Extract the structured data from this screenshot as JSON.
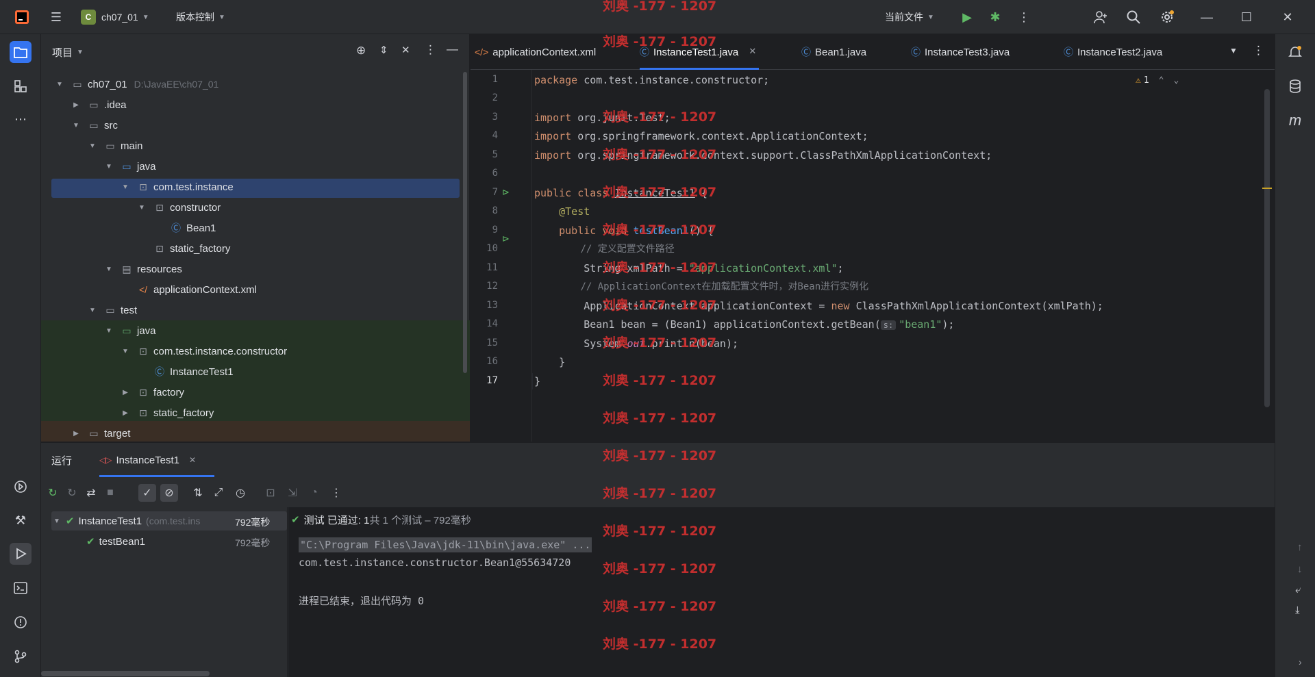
{
  "titlebar": {
    "project": "ch07_01",
    "project_badge": "C",
    "vcs": "版本控制",
    "run_config": "当前文件"
  },
  "project_panel": {
    "title": "项目",
    "tree": [
      {
        "label": "ch07_01",
        "extra": "D:\\JavaEE\\ch07_01",
        "icon": "folder-icon"
      },
      {
        "label": ".idea",
        "icon": "folder-icon"
      },
      {
        "label": "src",
        "icon": "folder-icon"
      },
      {
        "label": "main",
        "icon": "folder-icon"
      },
      {
        "label": "java",
        "icon": "source-folder-icon"
      },
      {
        "label": "com.test.instance",
        "icon": "package-icon"
      },
      {
        "label": "constructor",
        "icon": "package-icon"
      },
      {
        "label": "Bean1",
        "icon": "class-icon"
      },
      {
        "label": "static_factory",
        "icon": "package-icon"
      },
      {
        "label": "resources",
        "icon": "resources-folder-icon"
      },
      {
        "label": "applicationContext.xml",
        "icon": "xml-file-icon"
      },
      {
        "label": "test",
        "icon": "folder-icon"
      },
      {
        "label": "java",
        "icon": "test-folder-icon"
      },
      {
        "label": "com.test.instance.constructor",
        "icon": "package-icon"
      },
      {
        "label": "InstanceTest1",
        "icon": "class-icon"
      },
      {
        "label": "factory",
        "icon": "package-icon"
      },
      {
        "label": "static_factory",
        "icon": "package-icon"
      },
      {
        "label": "target",
        "icon": "folder-icon"
      }
    ]
  },
  "editor": {
    "tabs": [
      {
        "label": "applicationContext.xml",
        "icon": "xml-file-icon"
      },
      {
        "label": "InstanceTest1.java",
        "icon": "class-icon"
      },
      {
        "label": "Bean1.java",
        "icon": "class-icon"
      },
      {
        "label": "InstanceTest3.java",
        "icon": "class-icon"
      },
      {
        "label": "InstanceTest2.java",
        "icon": "class-icon"
      }
    ],
    "warning_count": "1",
    "line_numbers": [
      "1",
      "2",
      "3",
      "4",
      "5",
      "6",
      "7",
      "8",
      "9",
      "10",
      "11",
      "12",
      "13",
      "14",
      "15",
      "16",
      "17"
    ],
    "code": {
      "l1_kw": "package",
      "l1_rest": " com.test.instance.constructor;",
      "l3_kw": "import",
      "l3_rest": " org.junit.Test;",
      "l4_kw": "import",
      "l4_rest": " org.springframework.context.ApplicationContext;",
      "l5_kw": "import",
      "l5_rest": " org.springframework.context.support.ClassPathXmlApplicationContext;",
      "l7_kw": "public class",
      "l7_cls": "InstanceTest1",
      "l7_rest": " {",
      "l8_an": "@Test",
      "l9_kw": "public void",
      "l9_fn": "testBean1",
      "l9_rest": "() {",
      "l10_cm": "// 定义配置文件路径",
      "l11_a": "String xmlPath = ",
      "l11_str": "\"applicationContext.xml\"",
      "l11_b": ";",
      "l12_cm": "// ApplicationContext在加载配置文件时，对Bean进行实例化",
      "l13_a": "ApplicationContext applicationContext = ",
      "l13_kw": "new",
      "l13_b": " ClassPathXmlApplicationContext(xmlPath);",
      "l14_a": "Bean1 bean = (Bean1) applicationContext.getBean(",
      "l14_hint": "s:",
      "l14_str": "\"bean1\"",
      "l14_b": ");",
      "l15_a": "System.",
      "l15_it": "out",
      "l15_b": ".println(bean);",
      "l16": "}",
      "l17": "}"
    }
  },
  "run_panel": {
    "title": "运行",
    "tab": "InstanceTest1",
    "tests": [
      {
        "name": "InstanceTest1",
        "detail": "(com.test.ins",
        "time": "792毫秒"
      },
      {
        "name": "testBean1",
        "time": "792毫秒"
      }
    ],
    "status_prefix": "测试 已通过: 1",
    "status_suffix": "共 1 个测试 – 792毫秒",
    "console": [
      "\"C:\\Program Files\\Java\\jdk-11\\bin\\java.exe\" ...",
      "com.test.instance.constructor.Bean1@55634720",
      "",
      "进程已结束，退出代码为 0"
    ]
  },
  "watermark": "刘奥 -177 - 1207",
  "colors": {
    "accent": "#3574f0",
    "success": "#5fb865",
    "watermark": "#d03030",
    "selection": "#2e436e"
  }
}
